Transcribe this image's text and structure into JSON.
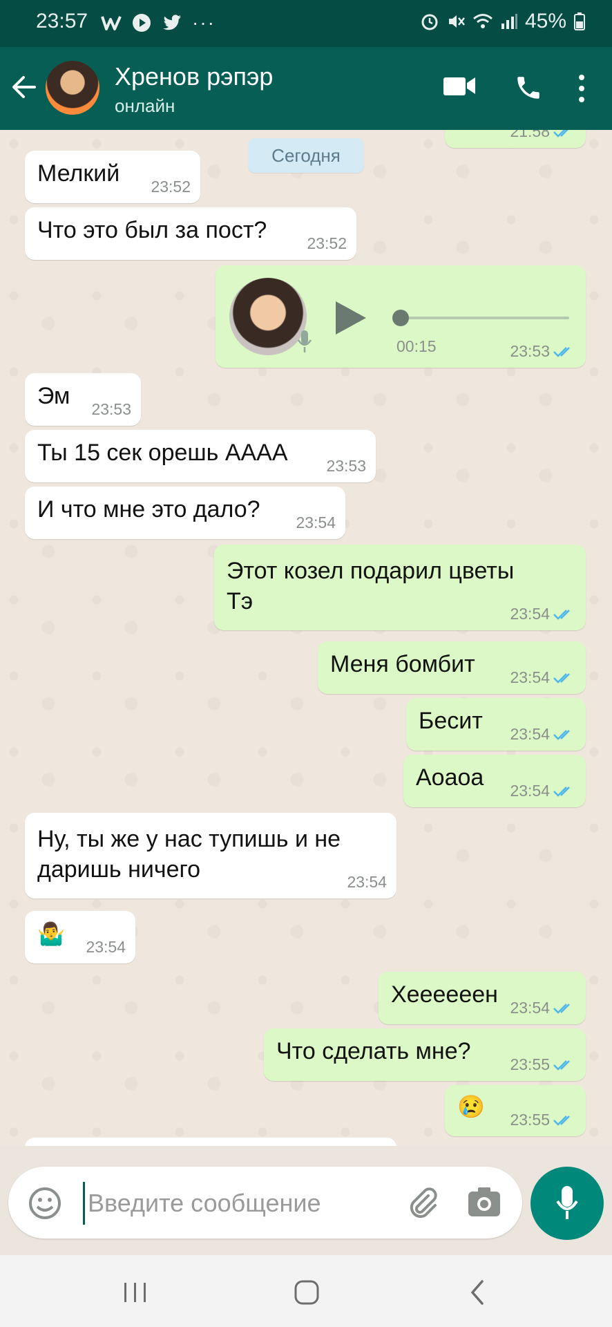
{
  "status_bar": {
    "time": "23:57",
    "battery": "45%"
  },
  "header": {
    "contact_name": "Хренов рэпэр",
    "contact_status": "онлайн",
    "icons": [
      "back-arrow-icon",
      "video-call-icon",
      "voice-call-icon",
      "more-vert-icon"
    ]
  },
  "chat": {
    "peek_time": "21:58",
    "date_chip": "Сегодня",
    "messages": [
      {
        "text": "Мелкий",
        "time": "23:52"
      },
      {
        "text": "Что это был за пост?",
        "time": "23:52"
      },
      {
        "voice_duration": "00:15",
        "time": "23:53"
      },
      {
        "text": "Эм",
        "time": "23:53"
      },
      {
        "text": "Ты 15 сек орешь АААА",
        "time": "23:53"
      },
      {
        "text": "И что мне это дало?",
        "time": "23:54"
      },
      {
        "line1": "Этот козел подарил цветы",
        "line2": "Тэ",
        "time": "23:54"
      },
      {
        "text": "Меня бомбит",
        "time": "23:54"
      },
      {
        "text": "Бесит",
        "time": "23:54"
      },
      {
        "text": "Аоаоа",
        "time": "23:54"
      },
      {
        "line1": "Ну, ты же у нас тупишь и не",
        "line2": "даришь ничего",
        "time": "23:54"
      },
      {
        "emoji": "🤷‍♂️",
        "time": "23:54"
      },
      {
        "text": "Хеееееен",
        "time": "23:54"
      },
      {
        "text": "Что сделать мне?",
        "time": "23:55"
      },
      {
        "emoji": "😢",
        "time": "23:55"
      }
    ]
  },
  "composer": {
    "placeholder": "Введите сообщение"
  },
  "colors": {
    "header": "#075e54",
    "status_bar": "#054d44",
    "outgoing": "#dcf8c6",
    "incoming": "#ffffff",
    "tick_read": "#4fb6ec"
  }
}
